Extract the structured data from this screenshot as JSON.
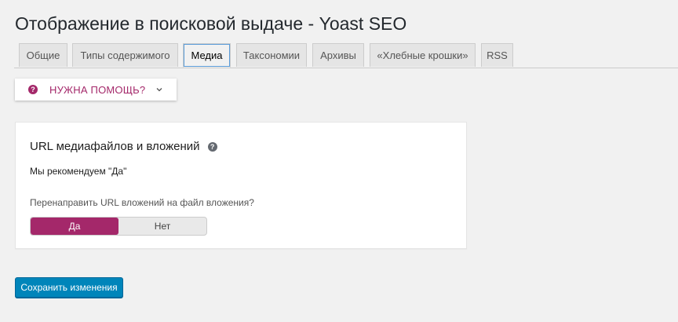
{
  "page": {
    "title": "Отображение в поисковой выдаче - Yoast SEO"
  },
  "tabs": [
    {
      "label": "Общие",
      "active": false
    },
    {
      "label": "Типы содержимого",
      "active": false
    },
    {
      "label": "Медиа",
      "active": true
    },
    {
      "label": "Таксономии",
      "active": false
    },
    {
      "label": "Архивы",
      "active": false
    },
    {
      "label": "«Хлебные крошки»",
      "active": false
    },
    {
      "label": "RSS",
      "active": false
    }
  ],
  "help": {
    "label": "НУЖНА ПОМОЩЬ?",
    "icon": "question-circle-icon",
    "chevron_icon": "chevron-down-icon"
  },
  "section": {
    "title": "URL медиафайлов и вложений",
    "help_icon": "question-circle-icon",
    "recommendation": "Мы рекомендуем \"Да\"",
    "question": "Перенаправить URL вложений на файл вложения?",
    "toggle": {
      "options": [
        "Да",
        "Нет"
      ],
      "selected": "Да"
    }
  },
  "footer": {
    "save_label": "Сохранить изменения"
  },
  "colors": {
    "brand": "#a4286a",
    "primary_button": "#0085ba",
    "background": "#f1f1f1"
  }
}
